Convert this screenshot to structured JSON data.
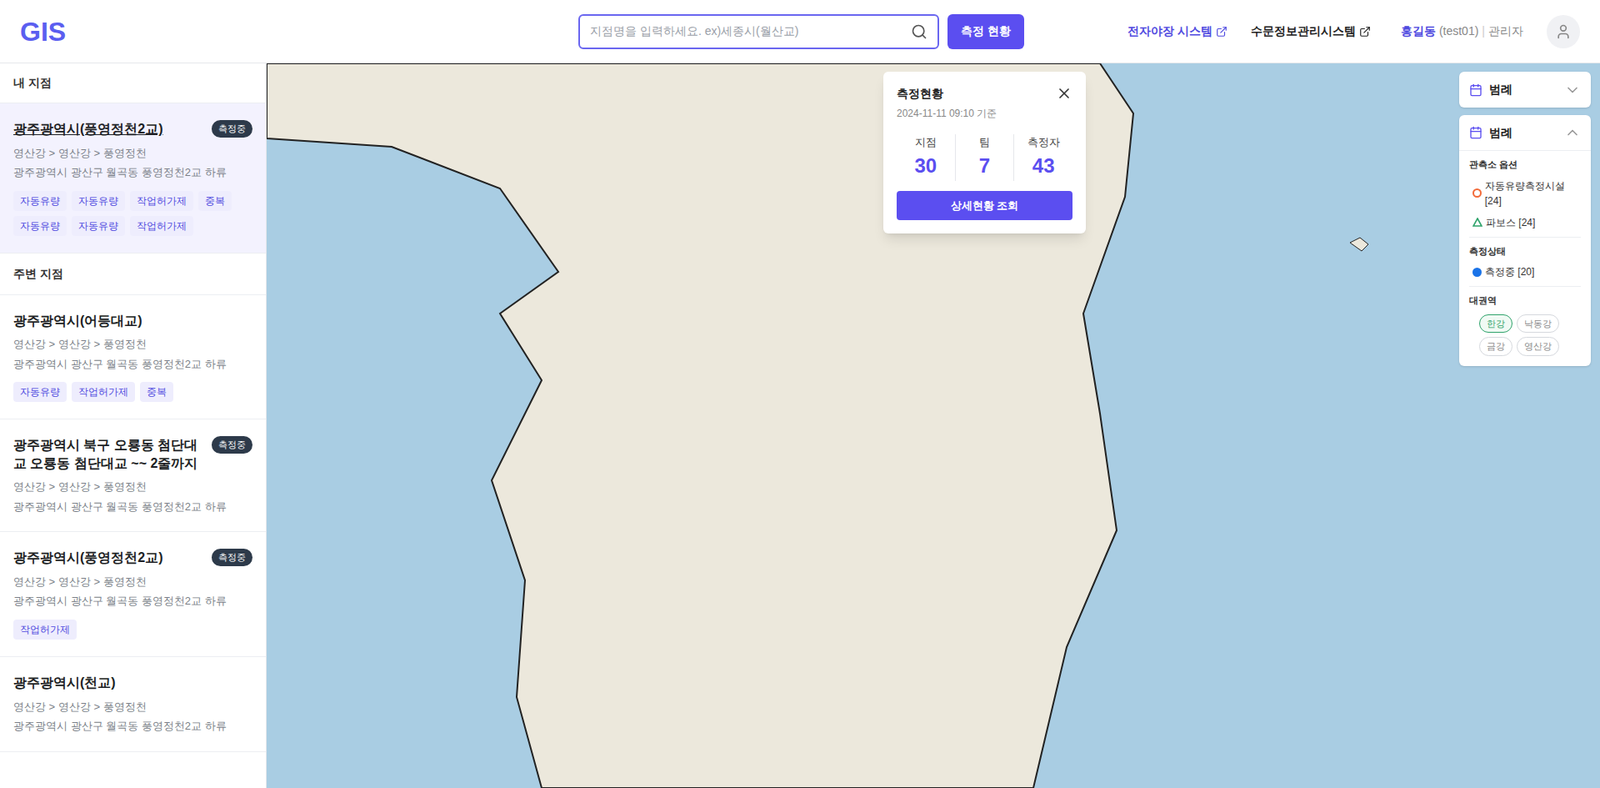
{
  "header": {
    "logo": "GIS",
    "search_placeholder": "지점명을 입력하세요. ex)세종시(월산교)",
    "status_button": "측정 현황",
    "links": [
      {
        "label": "전자야장 시스템",
        "highlighted": true
      },
      {
        "label": "수문정보관리시스템",
        "highlighted": false
      }
    ],
    "user": {
      "name": "홍길동",
      "id": "(test01)",
      "separator": "|",
      "role": "관리자"
    }
  },
  "sidebar": {
    "my_title": "내 지점",
    "my_items": [
      {
        "title": "광주광역시(풍영정천2교)",
        "badge": "측정중",
        "path": "영산강 > 영산강 > 풍영정천",
        "address": "광주광역시 광산구 월곡동 풍영정천2교 하류",
        "tags": [
          "자동유량",
          "자동유량",
          "작업허가제",
          "중복",
          "자동유량",
          "자동유량",
          "작업허가제"
        ],
        "selected": true
      }
    ],
    "nearby_title": "주변 지점",
    "nearby_items": [
      {
        "title": "광주광역시(어등대교)",
        "badge": "",
        "path": "영산강 > 영산강 > 풍영정천",
        "address": "광주광역시 광산구 월곡동 풍영정천2교 하류",
        "tags": [
          "자동유량",
          "작업허가제",
          "중복"
        ],
        "selected": false
      },
      {
        "title": "광주광역시 북구 오룡동 첨단대교 오룡동 첨단대교 ~~ 2줄까지",
        "badge": "측정중",
        "path": "영산강 > 영산강 > 풍영정천",
        "address": "광주광역시 광산구 월곡동 풍영정천2교 하류",
        "tags": [],
        "selected": false
      },
      {
        "title": "광주광역시(풍영정천2교)",
        "badge": "측정중",
        "path": "영산강 > 영산강 > 풍영정천",
        "address": "광주광역시 광산구 월곡동 풍영정천2교 하류",
        "tags": [
          "작업허가제"
        ],
        "selected": false
      },
      {
        "title": "광주광역시(천교)",
        "badge": "",
        "path": "영산강 > 영산강 > 풍영정천",
        "address": "광주광역시 광산구 월곡동 풍영정천2교 하류",
        "tags": [],
        "selected": false
      }
    ]
  },
  "popup": {
    "title": "측정현황",
    "time": "2024-11-11 09:10 기준",
    "stats": [
      {
        "label": "지점",
        "value": "30"
      },
      {
        "label": "팀",
        "value": "7"
      },
      {
        "label": "측정자",
        "value": "43"
      }
    ],
    "button": "상세현황 조회"
  },
  "legends": [
    {
      "title": "범례",
      "expanded": false
    },
    {
      "title": "범례",
      "expanded": true,
      "station_title": "관측소 옵션",
      "stations": [
        {
          "kind": "circle",
          "label": "자동유량측정시설 [24]",
          "color": "#f26b3a"
        },
        {
          "kind": "triangle",
          "label": "파보스 [24]",
          "color": "#2fa36b"
        }
      ],
      "status_title": "측정상태",
      "statuses": [
        {
          "label": "측정중 [20]",
          "color": "#1a73e8"
        }
      ],
      "region_title": "대권역",
      "regions": [
        {
          "label": "한강",
          "selected": true
        },
        {
          "label": "낙동강",
          "selected": false
        },
        {
          "label": "금강",
          "selected": false
        },
        {
          "label": "영산강",
          "selected": false
        }
      ]
    }
  ]
}
